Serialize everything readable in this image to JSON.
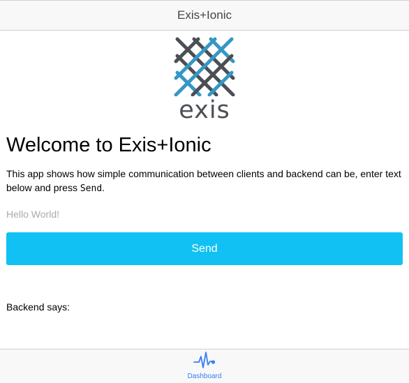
{
  "header": {
    "title": "Exis+Ionic"
  },
  "logo": {
    "word": "exis"
  },
  "main": {
    "heading": "Welcome to Exis+Ionic",
    "intro_before": "This app shows how simple communication between clients and backend can be, enter text below and press ",
    "intro_code": "Send",
    "intro_after": ".",
    "input": {
      "placeholder": "Hello World!",
      "value": ""
    },
    "send_label": "Send",
    "backend_label": "Backend says:"
  },
  "tabs": [
    {
      "label": "Dashboard",
      "icon": "pulse-icon",
      "active": true
    }
  ],
  "colors": {
    "accent": "#11c1f3",
    "tab_active": "#387ef5",
    "logo_blue": "#3497c4",
    "logo_gray": "#4b4f54"
  }
}
